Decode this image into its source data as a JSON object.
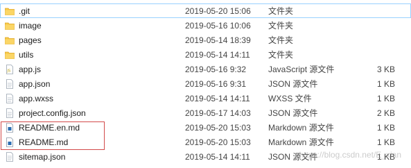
{
  "files": [
    {
      "name": ".git",
      "date": "2019-05-20 15:06",
      "type": "文件夹",
      "size": "",
      "icon": "folder-icon",
      "selected": true
    },
    {
      "name": "image",
      "date": "2019-05-16 10:06",
      "type": "文件夹",
      "size": "",
      "icon": "folder-icon"
    },
    {
      "name": "pages",
      "date": "2019-05-14 18:39",
      "type": "文件夹",
      "size": "",
      "icon": "folder-icon"
    },
    {
      "name": "utils",
      "date": "2019-05-14 14:11",
      "type": "文件夹",
      "size": "",
      "icon": "folder-icon"
    },
    {
      "name": "app.js",
      "date": "2019-05-16 9:32",
      "type": "JavaScript 源文件",
      "size": "3 KB",
      "icon": "js-file-icon"
    },
    {
      "name": "app.json",
      "date": "2019-05-16 9:31",
      "type": "JSON 源文件",
      "size": "1 KB",
      "icon": "text-file-icon"
    },
    {
      "name": "app.wxss",
      "date": "2019-05-14 14:11",
      "type": "WXSS 文件",
      "size": "1 KB",
      "icon": "text-file-icon"
    },
    {
      "name": "project.config.json",
      "date": "2019-05-17 14:03",
      "type": "JSON 源文件",
      "size": "2 KB",
      "icon": "text-file-icon"
    },
    {
      "name": "README.en.md",
      "date": "2019-05-20 15:03",
      "type": "Markdown 源文件",
      "size": "1 KB",
      "icon": "markdown-file-icon"
    },
    {
      "name": "README.md",
      "date": "2019-05-20 15:03",
      "type": "Markdown 源文件",
      "size": "1 KB",
      "icon": "markdown-file-icon"
    },
    {
      "name": "sitemap.json",
      "date": "2019-05-14 14:11",
      "type": "JSON 源文件",
      "size": "1 KB",
      "icon": "text-file-icon"
    }
  ],
  "watermark": "https://blog.csdn.net/E_xian",
  "colors": {
    "folder": "#f7c948",
    "folder_dark": "#e0a826",
    "selection_border": "#99d1ff",
    "highlight_box": "#d24a4a"
  }
}
